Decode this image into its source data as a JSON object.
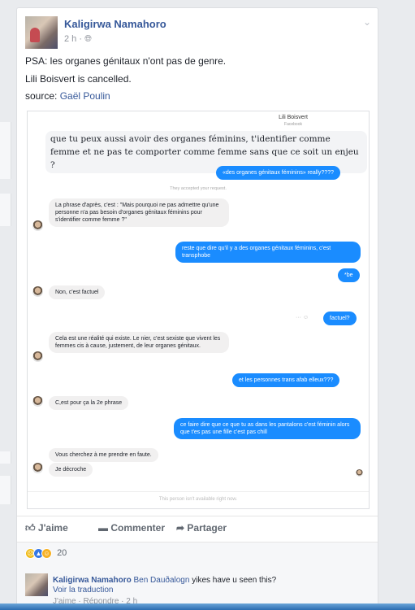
{
  "post": {
    "author": "Kaligirwa Namahoro",
    "time": "2 h · ",
    "line1": "PSA: les organes génitaux n'ont pas de genre.",
    "line2": "Lili Boisvert is cancelled.",
    "source_prefix": "source: ",
    "source_name": "Gaël Poulin"
  },
  "screenshot": {
    "title": "Lili Boisvert",
    "subtitle": "Facebook",
    "quoted": "que tu peux aussi avoir des organes féminins, t'identifier comme femme et ne pas te comporter comme femme sans que ce soit un enjeu ?",
    "msg1": "«des organes génitaux féminins» really????",
    "sys_accepted": "They accepted your request.",
    "msg2": "La phrase d'après, c'est : \"Mais pourquoi ne pas admettre qu'une personne n'a pas besoin d'organes génitaux féminins pour s'identifier comme femme ?\"",
    "msg3": "reste que dire qu'il y a des organes génitaux féminins, c'est transphobe",
    "msg4": "*be",
    "msg5": "Non, c'est factuel",
    "msg6": "factuel?",
    "msg7": "Cela est une réalité qui existe. Le nier, c'est sexiste que vivent les femmes cis à cause, justement, de leur organes génitaux.",
    "msg8": "et les personnes trans afab elleux???",
    "msg9": "C,est pour ça la 2e phrase",
    "msg10": "ce faire dire que ce que tu as dans les pantalons c'est féminin alors que t'es pas une fille c'est pas chill",
    "msg11": "Vous cherchez à me prendre en faute.",
    "msg12": "Je décroche",
    "footer": "This person isn't available right now."
  },
  "actions": {
    "like": "J'aime",
    "comment": "Commenter",
    "share": "Partager"
  },
  "reactions": {
    "count": "20"
  },
  "comment": {
    "author": "Kaligirwa Namahoro",
    "mention": "Ben Dauðalogn",
    "text": " yikes have u seen this?",
    "translate": "Voir la traduction",
    "meta": "J'aime · Répondre · 2 h"
  }
}
